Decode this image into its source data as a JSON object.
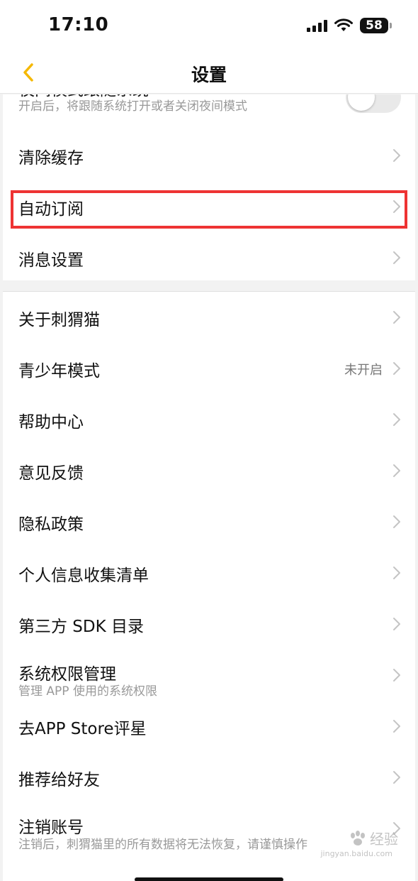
{
  "status_bar": {
    "time": "17:10",
    "battery": "58"
  },
  "header": {
    "title": "设置",
    "back_icon": "chevron-left-icon",
    "accent_color": "#f5b800"
  },
  "section1": {
    "night_mode": {
      "label": "夜间模式跟随系统",
      "description": "开启后，将跟随系统打开或者关闭夜间模式",
      "toggle_on": false
    },
    "clear_cache": {
      "label": "清除缓存"
    },
    "auto_subscribe": {
      "label": "自动订阅"
    },
    "message_settings": {
      "label": "消息设置"
    }
  },
  "section2": {
    "about": {
      "label": "关于刺猬猫"
    },
    "youth_mode": {
      "label": "青少年模式",
      "value": "未开启"
    },
    "help": {
      "label": "帮助中心"
    },
    "feedback": {
      "label": "意见反馈"
    },
    "privacy": {
      "label": "隐私政策"
    },
    "personal_info": {
      "label": "个人信息收集清单"
    },
    "sdk_list": {
      "label": "第三方 SDK 目录"
    },
    "permissions": {
      "label": "系统权限管理",
      "description": "管理 APP 使用的系统权限"
    },
    "rate": {
      "label": "去APP Store评星"
    },
    "recommend": {
      "label": "推荐给好友"
    },
    "delete_account": {
      "label": "注销账号",
      "description": "注销后，刺猬猫里的所有数据将无法恢复，请谨慎操作"
    }
  },
  "highlight_color": "#ee3333",
  "watermark": {
    "text": "经验",
    "sub": "jingyan.baidu.com"
  }
}
